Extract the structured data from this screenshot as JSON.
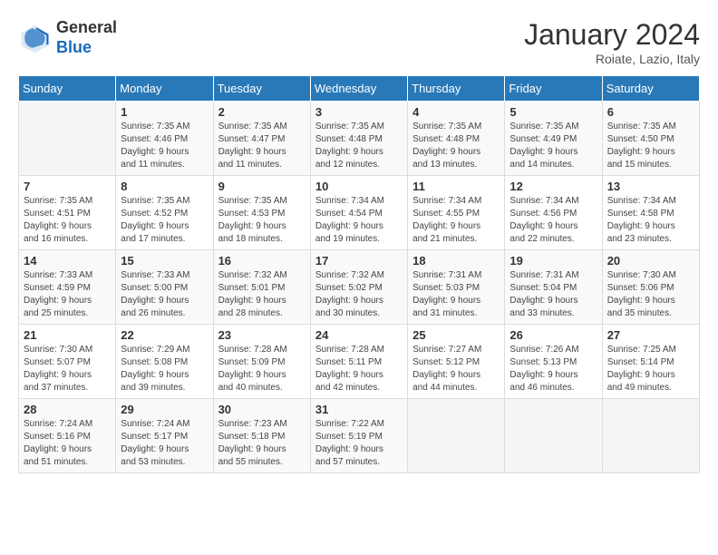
{
  "header": {
    "logo_line1": "General",
    "logo_line2": "Blue",
    "month_title": "January 2024",
    "subtitle": "Roiate, Lazio, Italy"
  },
  "weekdays": [
    "Sunday",
    "Monday",
    "Tuesday",
    "Wednesday",
    "Thursday",
    "Friday",
    "Saturday"
  ],
  "weeks": [
    [
      {
        "day": "",
        "info": ""
      },
      {
        "day": "1",
        "info": "Sunrise: 7:35 AM\nSunset: 4:46 PM\nDaylight: 9 hours\nand 11 minutes."
      },
      {
        "day": "2",
        "info": "Sunrise: 7:35 AM\nSunset: 4:47 PM\nDaylight: 9 hours\nand 11 minutes."
      },
      {
        "day": "3",
        "info": "Sunrise: 7:35 AM\nSunset: 4:48 PM\nDaylight: 9 hours\nand 12 minutes."
      },
      {
        "day": "4",
        "info": "Sunrise: 7:35 AM\nSunset: 4:48 PM\nDaylight: 9 hours\nand 13 minutes."
      },
      {
        "day": "5",
        "info": "Sunrise: 7:35 AM\nSunset: 4:49 PM\nDaylight: 9 hours\nand 14 minutes."
      },
      {
        "day": "6",
        "info": "Sunrise: 7:35 AM\nSunset: 4:50 PM\nDaylight: 9 hours\nand 15 minutes."
      }
    ],
    [
      {
        "day": "7",
        "info": "Sunrise: 7:35 AM\nSunset: 4:51 PM\nDaylight: 9 hours\nand 16 minutes."
      },
      {
        "day": "8",
        "info": "Sunrise: 7:35 AM\nSunset: 4:52 PM\nDaylight: 9 hours\nand 17 minutes."
      },
      {
        "day": "9",
        "info": "Sunrise: 7:35 AM\nSunset: 4:53 PM\nDaylight: 9 hours\nand 18 minutes."
      },
      {
        "day": "10",
        "info": "Sunrise: 7:34 AM\nSunset: 4:54 PM\nDaylight: 9 hours\nand 19 minutes."
      },
      {
        "day": "11",
        "info": "Sunrise: 7:34 AM\nSunset: 4:55 PM\nDaylight: 9 hours\nand 21 minutes."
      },
      {
        "day": "12",
        "info": "Sunrise: 7:34 AM\nSunset: 4:56 PM\nDaylight: 9 hours\nand 22 minutes."
      },
      {
        "day": "13",
        "info": "Sunrise: 7:34 AM\nSunset: 4:58 PM\nDaylight: 9 hours\nand 23 minutes."
      }
    ],
    [
      {
        "day": "14",
        "info": "Sunrise: 7:33 AM\nSunset: 4:59 PM\nDaylight: 9 hours\nand 25 minutes."
      },
      {
        "day": "15",
        "info": "Sunrise: 7:33 AM\nSunset: 5:00 PM\nDaylight: 9 hours\nand 26 minutes."
      },
      {
        "day": "16",
        "info": "Sunrise: 7:32 AM\nSunset: 5:01 PM\nDaylight: 9 hours\nand 28 minutes."
      },
      {
        "day": "17",
        "info": "Sunrise: 7:32 AM\nSunset: 5:02 PM\nDaylight: 9 hours\nand 30 minutes."
      },
      {
        "day": "18",
        "info": "Sunrise: 7:31 AM\nSunset: 5:03 PM\nDaylight: 9 hours\nand 31 minutes."
      },
      {
        "day": "19",
        "info": "Sunrise: 7:31 AM\nSunset: 5:04 PM\nDaylight: 9 hours\nand 33 minutes."
      },
      {
        "day": "20",
        "info": "Sunrise: 7:30 AM\nSunset: 5:06 PM\nDaylight: 9 hours\nand 35 minutes."
      }
    ],
    [
      {
        "day": "21",
        "info": "Sunrise: 7:30 AM\nSunset: 5:07 PM\nDaylight: 9 hours\nand 37 minutes."
      },
      {
        "day": "22",
        "info": "Sunrise: 7:29 AM\nSunset: 5:08 PM\nDaylight: 9 hours\nand 39 minutes."
      },
      {
        "day": "23",
        "info": "Sunrise: 7:28 AM\nSunset: 5:09 PM\nDaylight: 9 hours\nand 40 minutes."
      },
      {
        "day": "24",
        "info": "Sunrise: 7:28 AM\nSunset: 5:11 PM\nDaylight: 9 hours\nand 42 minutes."
      },
      {
        "day": "25",
        "info": "Sunrise: 7:27 AM\nSunset: 5:12 PM\nDaylight: 9 hours\nand 44 minutes."
      },
      {
        "day": "26",
        "info": "Sunrise: 7:26 AM\nSunset: 5:13 PM\nDaylight: 9 hours\nand 46 minutes."
      },
      {
        "day": "27",
        "info": "Sunrise: 7:25 AM\nSunset: 5:14 PM\nDaylight: 9 hours\nand 49 minutes."
      }
    ],
    [
      {
        "day": "28",
        "info": "Sunrise: 7:24 AM\nSunset: 5:16 PM\nDaylight: 9 hours\nand 51 minutes."
      },
      {
        "day": "29",
        "info": "Sunrise: 7:24 AM\nSunset: 5:17 PM\nDaylight: 9 hours\nand 53 minutes."
      },
      {
        "day": "30",
        "info": "Sunrise: 7:23 AM\nSunset: 5:18 PM\nDaylight: 9 hours\nand 55 minutes."
      },
      {
        "day": "31",
        "info": "Sunrise: 7:22 AM\nSunset: 5:19 PM\nDaylight: 9 hours\nand 57 minutes."
      },
      {
        "day": "",
        "info": ""
      },
      {
        "day": "",
        "info": ""
      },
      {
        "day": "",
        "info": ""
      }
    ]
  ]
}
